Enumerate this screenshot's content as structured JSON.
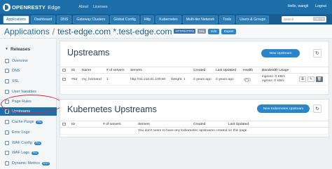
{
  "topbar": {
    "brand": "OPENRESTY",
    "product": "Edge",
    "nav": [
      "About",
      "Licenses"
    ],
    "user": "Hello, wangli",
    "logout": "Logout"
  },
  "tabs": [
    "Applications",
    "Dashboard",
    "DNS",
    "Gateway Clusters",
    "Global Config",
    "Http",
    "Kubernetes",
    "Multi-tier Network",
    "Tools",
    "Users & Groups"
  ],
  "search": {
    "placeholder": "Search",
    "shortcut": "Ctrl + K"
  },
  "header": {
    "crumb": "Applications",
    "separator": "/",
    "host": "test-edge.com *.test-edge.com",
    "badge_http": "HTTP/HTTPS",
    "badge_ssl": "SSL",
    "edit": "Edit",
    "export": "Export"
  },
  "sidebar": {
    "heading": "Releases",
    "items": [
      {
        "label": "Overview"
      },
      {
        "label": "DNS"
      },
      {
        "label": "SSL"
      },
      {
        "label": "User Variables"
      },
      {
        "label": "Page Rules"
      },
      {
        "label": "Upstreams"
      },
      {
        "label": "Cache Purge",
        "pill": "Pro"
      },
      {
        "label": "Error Logs"
      },
      {
        "label": "WAF Config",
        "pill": "Pro"
      },
      {
        "label": "WAF Logs",
        "pill": "Pro"
      },
      {
        "label": "Dynamic Metrics",
        "pill": "ENT"
      }
    ]
  },
  "upstreams": {
    "title": "Upstreams",
    "new_button": "New Upstream",
    "columns": [
      "ID",
      "Name",
      "# of servers",
      "Servers",
      "Created",
      "Last Updated",
      "Health",
      "Bandwidth Usage"
    ],
    "rows": [
      {
        "id": "#93",
        "name": "my_backend",
        "servers_count": "1",
        "server": "http://34.210.61.100:80",
        "weight": "Weight: 1",
        "created": "2 years ago",
        "updated": "2 years ago",
        "ingress": "ingress: 0 KB/s",
        "egress": "egress: 0 KB/s"
      }
    ]
  },
  "k8s": {
    "title": "Kubernetes Upstreams",
    "new_button": "New Kubernetes Upstream",
    "columns": [
      "ID",
      "# of servers",
      "Servers",
      "Created",
      "Last Updated"
    ],
    "empty": "You don't seem to have any kubernetes upstreams created on this page."
  }
}
